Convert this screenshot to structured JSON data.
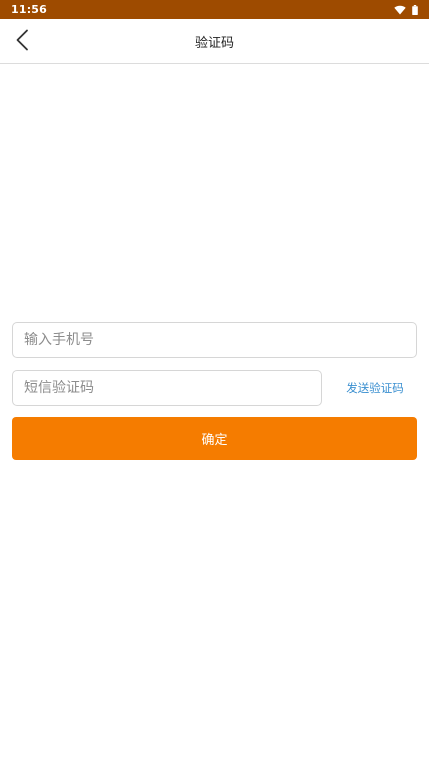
{
  "status_bar": {
    "time": "11:56",
    "icons": [
      "wifi-icon",
      "battery-icon"
    ],
    "background": "#9e4b00"
  },
  "nav": {
    "title": "验证码",
    "back_icon": "chevron-left-icon"
  },
  "form": {
    "phone": {
      "value": "",
      "placeholder": "输入手机号"
    },
    "code": {
      "value": "",
      "placeholder": "短信验证码"
    },
    "send_code_label": "发送验证码",
    "confirm_label": "确定"
  },
  "colors": {
    "accent": "#f57c00",
    "link": "#3a8fd0"
  }
}
